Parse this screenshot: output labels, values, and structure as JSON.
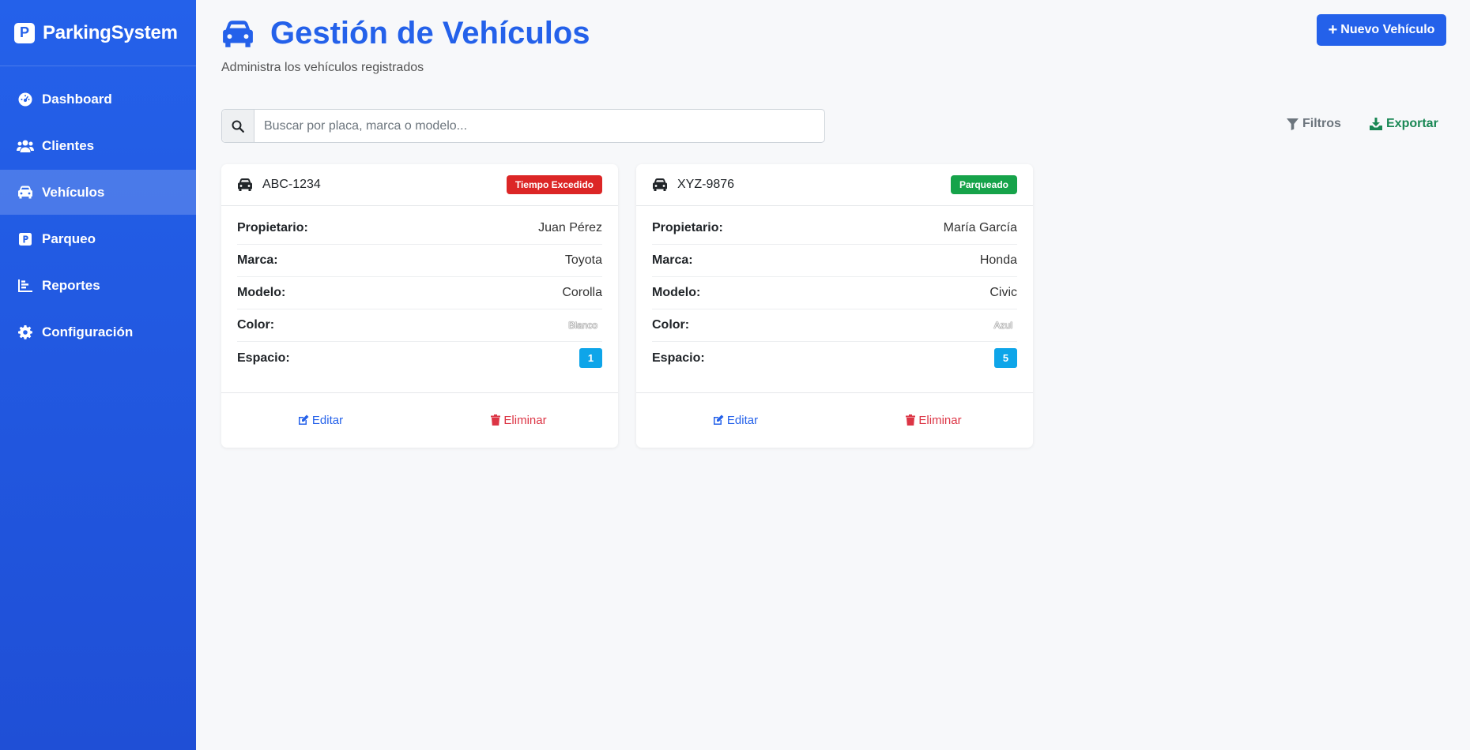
{
  "brand": {
    "logo_letter": "P",
    "name": "ParkingSystem"
  },
  "sidebar": {
    "items": [
      {
        "label": "Dashboard",
        "icon": "dashboard-icon",
        "active": false
      },
      {
        "label": "Clientes",
        "icon": "users-icon",
        "active": false
      },
      {
        "label": "Vehículos",
        "icon": "car-icon",
        "active": true
      },
      {
        "label": "Parqueo",
        "icon": "parking-icon",
        "active": false
      },
      {
        "label": "Reportes",
        "icon": "chart-icon",
        "active": false
      },
      {
        "label": "Configuración",
        "icon": "gear-icon",
        "active": false
      }
    ]
  },
  "header": {
    "title": "Gestión de Vehículos",
    "subtitle": "Administra los vehículos registrados",
    "new_button": "Nuevo Vehículo",
    "new_button_icon": "+"
  },
  "search": {
    "placeholder": "Buscar por placa, marca o modelo...",
    "value": ""
  },
  "toolbar": {
    "filters_label": "Filtros",
    "export_label": "Exportar"
  },
  "labels": {
    "owner": "Propietario:",
    "brand": "Marca:",
    "model": "Modelo:",
    "color": "Color:",
    "space": "Espacio:",
    "edit": "Editar",
    "delete": "Eliminar"
  },
  "vehicles": [
    {
      "plate": "ABC-1234",
      "status": "Tiempo Excedido",
      "status_color": "#dc2626",
      "owner": "Juan Pérez",
      "brand": "Toyota",
      "model": "Corolla",
      "color": "Blanco",
      "space": "1"
    },
    {
      "plate": "XYZ-9876",
      "status": "Parqueado",
      "status_color": "#16a34a",
      "owner": "María García",
      "brand": "Honda",
      "model": "Civic",
      "color": "Azul",
      "space": "5"
    }
  ],
  "colors": {
    "primary": "#2461ea",
    "danger": "#dc3545",
    "success": "#198754",
    "info": "#0ea5e9"
  }
}
